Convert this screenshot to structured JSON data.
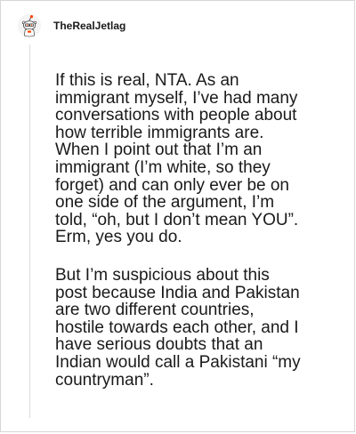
{
  "comment": {
    "author": "TheRealJetlag",
    "avatar_icon": "reddit-snoo-avatar-icon",
    "paragraphs": [
      "If this is real, NTA. As an\nimmigrant myself, I’ve had many\nconversations with people about\nhow terrible immigrants are.\nWhen I point out that I’m an\nimmigrant (I’m white, so they\nforget) and can only ever be on\none side of the argument, I’m\ntold, “oh, but I don’t mean YOU”.\nErm, yes you do.",
      "But I’m suspicious about this\npost because India and Pakistan\nare two different countries,\nhostile towards each other, and I\nhave serious doubts that an\nIndian would call a Pakistani “my\ncountryman”."
    ]
  },
  "colors": {
    "text": "#1a1a1b",
    "border": "#d6d6d6",
    "thread_line": "#dcdcdc",
    "avatar_accent": "#ff4500"
  }
}
